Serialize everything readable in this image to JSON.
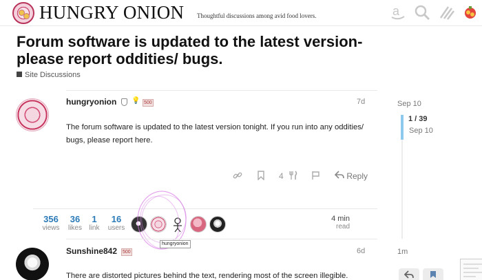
{
  "header": {
    "title": "HUNGRY ONION",
    "tagline": "Thoughtful discussions among avid food lovers.",
    "icons": [
      "amazon-icon",
      "search-icon",
      "menu-icon",
      "user-avatar"
    ]
  },
  "topic": {
    "title": "Forum software is updated to the latest version- please report oddities/ bugs.",
    "category": "Site Discussions"
  },
  "posts": [
    {
      "username": "hungryonion",
      "badge": "500",
      "date": "7d",
      "body": "The forum software is updated to the latest version tonight. If you run into any oddities/ bugs, please report here.",
      "like_count": "4",
      "reply_label": "Reply"
    },
    {
      "username": "Sunshine842",
      "badge": "500",
      "date": "6d",
      "body": "There are distorted pictures behind the text, rendering most of the screen illegible."
    }
  ],
  "stats": [
    {
      "num": "356",
      "label": "views"
    },
    {
      "num": "36",
      "label": "likes"
    },
    {
      "num": "1",
      "label": "link"
    },
    {
      "num": "16",
      "label": "users"
    }
  ],
  "read_time": {
    "num": "4 min",
    "label": "read"
  },
  "tooltip": "hungryonion",
  "timeline": {
    "top_date": "Sep 10",
    "position": "1 / 39",
    "current_date": "Sep 10",
    "bottom_label": "1m"
  },
  "colors": {
    "accent": "#2a7ab8",
    "timeline_handle": "#8cc9ec",
    "brand": "#b8325a"
  }
}
